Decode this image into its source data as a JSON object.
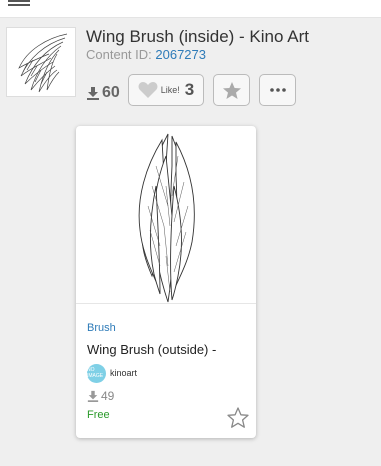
{
  "header": {
    "title": "Wing Brush (inside) - Kino Art",
    "content_id_label": "Content ID:",
    "content_id": "2067273",
    "download_count": "60",
    "like_label": "Like!",
    "like_count": "3"
  },
  "card": {
    "category": "Brush",
    "title": "Wing Brush (outside) -",
    "avatar_text": "NO IMAGE",
    "author": "kinoart",
    "download_count": "49",
    "price": "Free"
  },
  "colors": {
    "accent_link": "#2e7bb8",
    "free_green": "#2a9a2a",
    "avatar_bg": "#7fd0e6"
  },
  "icons": {
    "menu": "hamburger-icon",
    "download": "download-icon",
    "like": "heart-icon",
    "favorite": "star-icon",
    "more": "more-icon"
  }
}
